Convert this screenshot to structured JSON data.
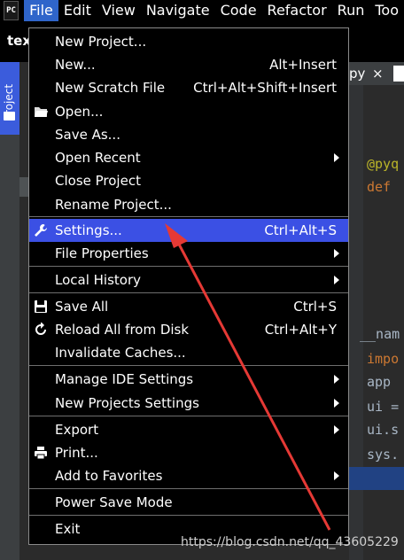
{
  "menubar": {
    "logo_text": "PC",
    "items": [
      "File",
      "Edit",
      "View",
      "Navigate",
      "Code",
      "Refactor",
      "Run",
      "Too"
    ]
  },
  "titlebar": {
    "project": "tex"
  },
  "side_panel": {
    "project_label": "Project"
  },
  "editor": {
    "tab_label": "py",
    "tab_close": "×",
    "code_lines": [
      "@pyq",
      "def",
      "__nam",
      "impo",
      "app",
      "ui =",
      "ui.s",
      "sys."
    ]
  },
  "file_menu": {
    "new_project": "New Project...",
    "new": "New...",
    "new_sc": "Alt+Insert",
    "new_scratch": "New Scratch File",
    "new_scratch_sc": "Ctrl+Alt+Shift+Insert",
    "open": "Open...",
    "save_as": "Save As...",
    "open_recent": "Open Recent",
    "close_project": "Close Project",
    "rename_project": "Rename Project...",
    "settings": "Settings...",
    "settings_sc": "Ctrl+Alt+S",
    "file_properties": "File Properties",
    "local_history": "Local History",
    "save_all": "Save All",
    "save_all_sc": "Ctrl+S",
    "reload": "Reload All from Disk",
    "reload_sc": "Ctrl+Alt+Y",
    "invalidate": "Invalidate Caches...",
    "manage_ide": "Manage IDE Settings",
    "new_projects_settings": "New Projects Settings",
    "export": "Export",
    "print": "Print...",
    "add_favorites": "Add to Favorites",
    "power_save": "Power Save Mode",
    "exit": "Exit"
  },
  "watermark": "https://blog.csdn.net/qq_43605229",
  "colors": {
    "accent": "#3b50e4",
    "arrow": "#e53935",
    "menu_bg": "#000000"
  }
}
